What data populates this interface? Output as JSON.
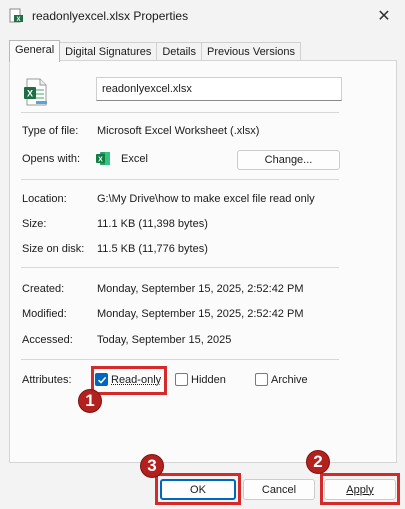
{
  "window": {
    "title": "readonlyexcel.xlsx Properties",
    "close_icon": "close-icon"
  },
  "tabs": [
    {
      "label": "General",
      "active": true
    },
    {
      "label": "Digital Signatures",
      "active": false
    },
    {
      "label": "Details",
      "active": false
    },
    {
      "label": "Previous Versions",
      "active": false
    }
  ],
  "file": {
    "name": "readonlyexcel.xlsx"
  },
  "properties": {
    "type": {
      "label": "Type of file:",
      "value": "Microsoft Excel Worksheet (.xlsx)"
    },
    "opens_with": {
      "label": "Opens with:",
      "value": "Excel",
      "change_label": "Change..."
    },
    "location": {
      "label": "Location:",
      "value": "G:\\My Drive\\how to make excel file read only"
    },
    "size": {
      "label": "Size:",
      "value": "11.1 KB (11,398 bytes)"
    },
    "size_on_disk": {
      "label": "Size on disk:",
      "value": "11.5 KB (11,776 bytes)"
    },
    "created": {
      "label": "Created:",
      "value": "Monday, September 15, 2025, 2:52:42 PM"
    },
    "modified": {
      "label": "Modified:",
      "value": "Monday, September 15, 2025, 2:52:42 PM"
    },
    "accessed": {
      "label": "Accessed:",
      "value": "Today, September 15, 2025"
    }
  },
  "attributes": {
    "label": "Attributes:",
    "read_only": {
      "label": "Read-only",
      "checked": true
    },
    "hidden": {
      "label": "Hidden",
      "checked": false
    },
    "archive": {
      "label": "Archive",
      "checked": false
    }
  },
  "buttons": {
    "ok": "OK",
    "cancel": "Cancel",
    "apply": "Apply"
  },
  "markers": {
    "one": "1",
    "two": "2",
    "three": "3"
  },
  "colors": {
    "accent": "#0067c0",
    "highlight": "#d42a2a",
    "marker": "#b2211e",
    "excel_green": "#1d6f42"
  }
}
